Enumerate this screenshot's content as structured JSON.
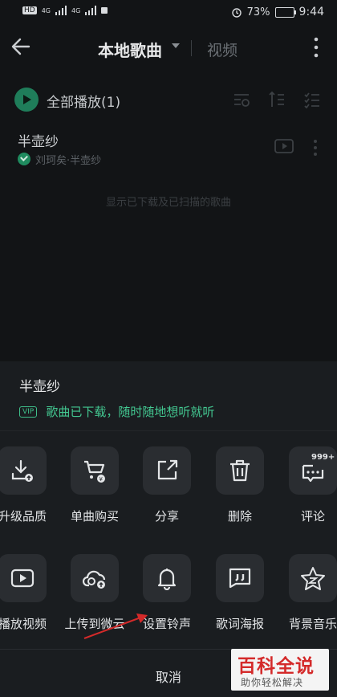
{
  "status_bar": {
    "left_indicators": [
      "HD",
      "4G",
      "4G"
    ],
    "battery": "73%",
    "time": "9:44"
  },
  "header": {
    "title": "本地歌曲",
    "tab2": "视频",
    "icons": [
      "back-arrow-icon",
      "caret-down-icon",
      "more-vertical-icon"
    ]
  },
  "list": {
    "play_all": "全部播放(1)",
    "toolbar_icons": [
      "view-filter-icon",
      "sort-icon",
      "multi-select-icon"
    ],
    "songs": [
      {
        "title": "半壶纱",
        "subtitle": "刘珂矣·半壶纱"
      }
    ],
    "hint": "显示已下载及已扫描的歌曲"
  },
  "sheet": {
    "song_title": "半壶纱",
    "vip_badge": "VIP",
    "status_text": "歌曲已下载，随时随地想听就听",
    "row1": [
      {
        "label": "升级品质",
        "icon": "download-upgrade-icon"
      },
      {
        "label": "单曲购买",
        "icon": "cart-icon"
      },
      {
        "label": "分享",
        "icon": "share-icon"
      },
      {
        "label": "删除",
        "icon": "trash-icon"
      },
      {
        "label": "评论",
        "icon": "comment-icon",
        "badge": "999+"
      }
    ],
    "row2": [
      {
        "label": "播放视频",
        "icon": "video-play-icon"
      },
      {
        "label": "上传到微云",
        "icon": "cloud-upload-icon"
      },
      {
        "label": "设置铃声",
        "icon": "bell-icon"
      },
      {
        "label": "歌词海报",
        "icon": "lyrics-poster-icon"
      },
      {
        "label": "背景音乐",
        "icon": "star-music-icon"
      }
    ],
    "cancel": "取消"
  },
  "watermark": {
    "title": "百科全说",
    "subtitle": "助你轻松解决"
  },
  "colors": {
    "background": "#121416",
    "sheet": "#1a1d20",
    "tile": "#2a2d31",
    "accent_green": "#43c891",
    "annotation_red": "#d42a2a"
  }
}
